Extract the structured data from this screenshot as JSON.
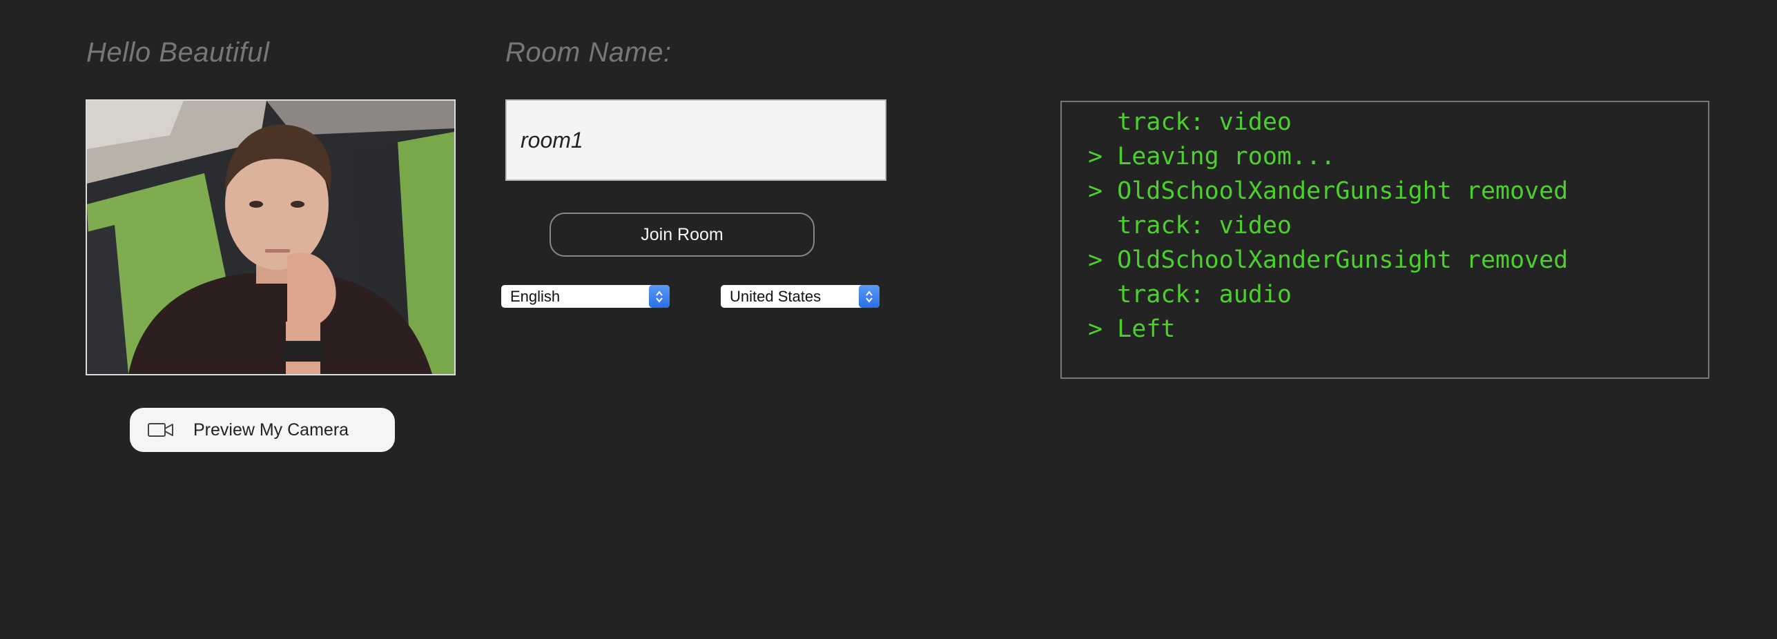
{
  "greeting": "Hello Beautiful",
  "room": {
    "label": "Room Name:",
    "value": "room1",
    "join_label": "Join Room"
  },
  "camera": {
    "preview_label": "Preview My Camera",
    "icon": "video-camera-icon"
  },
  "language_select": {
    "selected": "English"
  },
  "region_select": {
    "selected": "United States"
  },
  "log": {
    "lines": [
      "  track: video",
      "> Leaving room...",
      "> OldSchoolXanderGunsight removed",
      "  track: video",
      "> OldSchoolXanderGunsight removed",
      "  track: audio",
      "> Left"
    ]
  },
  "colors": {
    "background": "#232323",
    "log_text": "#4bd12b",
    "heading": "#777777",
    "select_accent": "#2a6ee8"
  }
}
